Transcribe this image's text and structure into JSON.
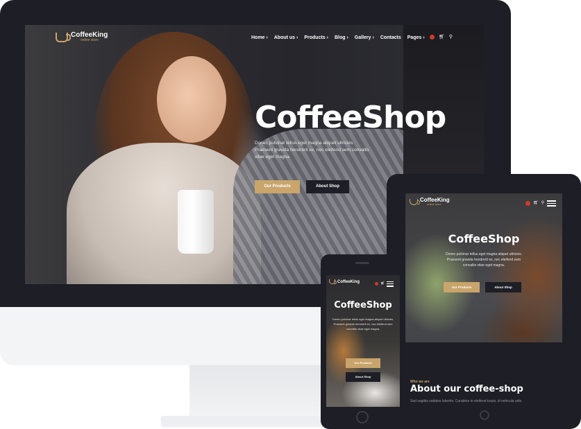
{
  "brand": {
    "name": "CoffeeKing",
    "tagline": "online store"
  },
  "colors": {
    "accent": "#c9a46b",
    "dark": "#1d1e26",
    "cart_badge": "#d23a25"
  },
  "icons": {
    "logo": "coffee-cup-icon",
    "cart": "cart-icon",
    "search": "search-icon",
    "menu": "hamburger-menu-icon"
  },
  "desktop": {
    "nav": [
      {
        "label": "Home ›"
      },
      {
        "label": "About us ›"
      },
      {
        "label": "Products ›"
      },
      {
        "label": "Blog ›"
      },
      {
        "label": "Gallery ›"
      },
      {
        "label": "Contacts"
      },
      {
        "label": "Pages ›"
      }
    ],
    "hero_title": "CoffeeShop",
    "hero_text": "Donec pulvinar tellus eget magna aliquet ultricies. Praesent gravida hendrerit ex, nec eleifend sem convallis vitae eget magna.",
    "btn_products": "Our Products",
    "btn_about": "About Shop"
  },
  "tablet": {
    "hero_title": "CoffeeShop",
    "hero_text": "Donec pulvinar tellus eget magna aliquet ultricies. Praesent gravida hendrerit ex, nec eleifend sem convallis vitae eget magna.",
    "btn_products": "Our Products",
    "btn_about": "About Shop",
    "kicker": "Who we are",
    "section_title": "About our coffee-shop",
    "section_text": "Sed sagittis sodales lobortis. Curabitur in eleifend turpis, id vehicula odio"
  },
  "phone": {
    "hero_title": "CoffeeShop",
    "hero_text": "Donec pulvinar tellus eget magna aliquet ultricies. Praesent gravida hendrerit ex, nec eleifend sem convallis vitae eget magna.",
    "btn_products": "Our Products",
    "btn_about": "About Shop"
  }
}
